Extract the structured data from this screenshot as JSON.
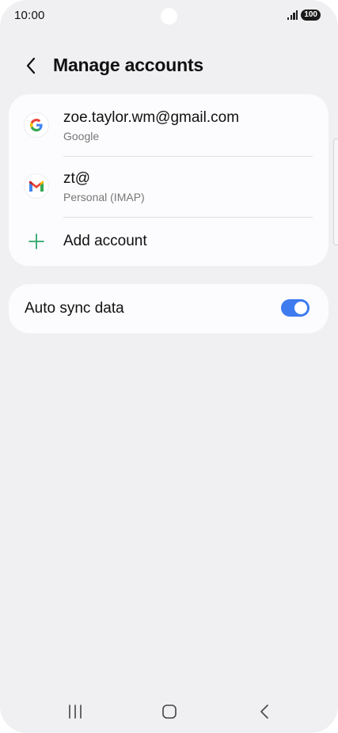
{
  "status_bar": {
    "time": "10:00",
    "battery": "100"
  },
  "header": {
    "title": "Manage accounts"
  },
  "accounts": [
    {
      "email": "zoe.taylor.wm@gmail.com",
      "type": "Google",
      "icon": "google-icon"
    },
    {
      "email": "zt@",
      "type": "Personal (IMAP)",
      "icon": "gmail-icon"
    }
  ],
  "add_account": {
    "label": "Add account",
    "icon": "plus-icon",
    "color": "#2ba66a"
  },
  "sync": {
    "label": "Auto sync data",
    "enabled": true,
    "accent": "#3e7bef"
  },
  "nav": {
    "recents_icon": "recents-icon",
    "home_icon": "home-icon",
    "back_icon": "back-icon"
  }
}
